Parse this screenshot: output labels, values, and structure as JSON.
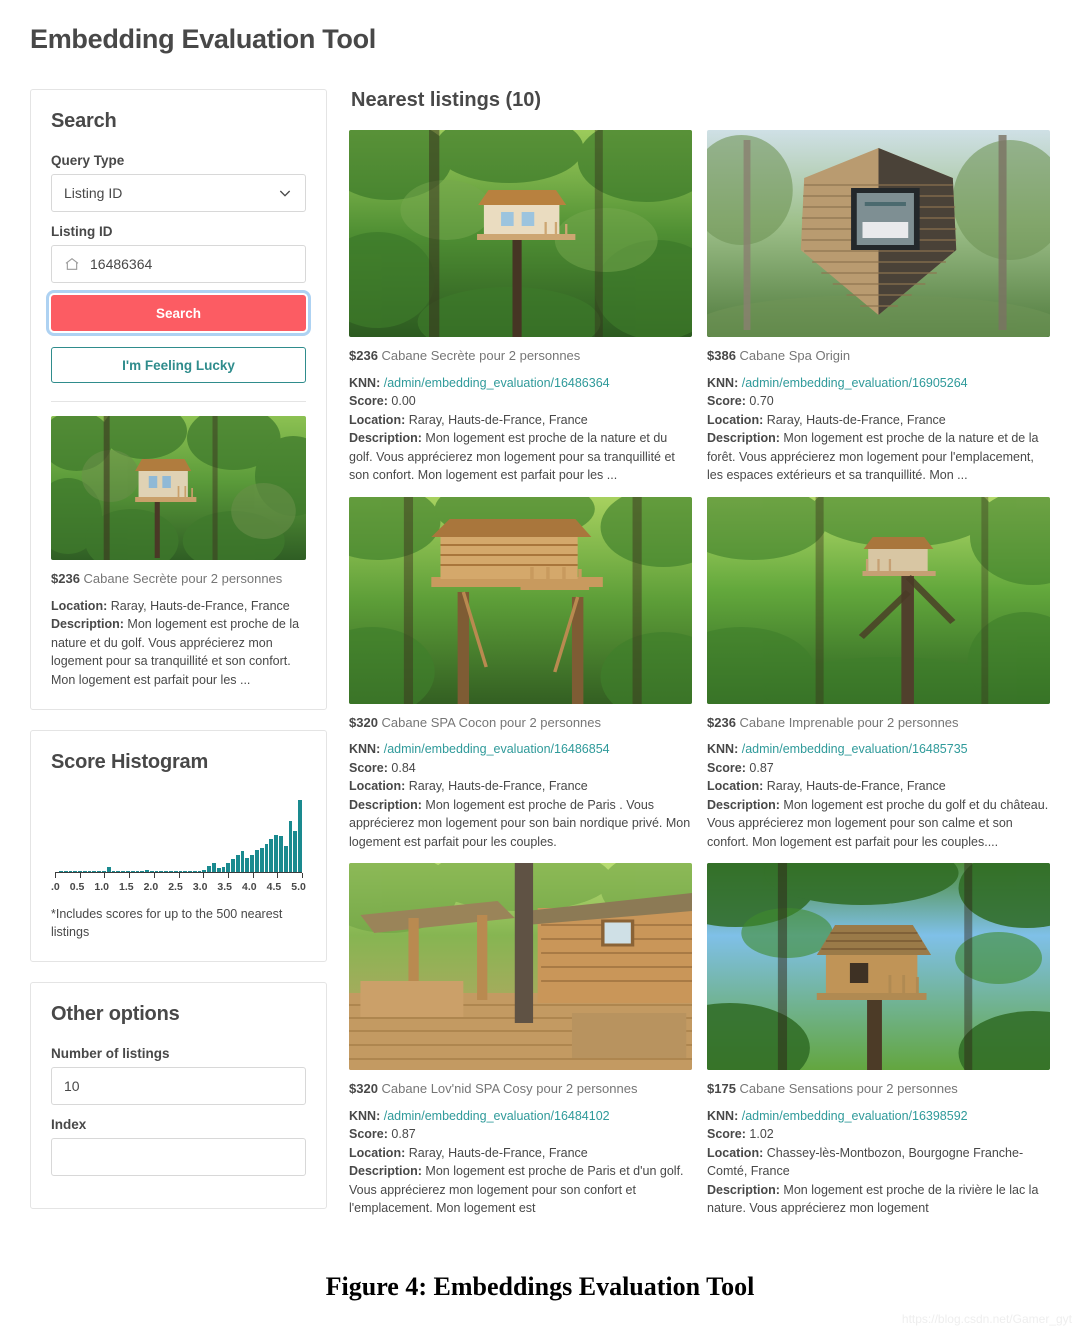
{
  "page": {
    "title": "Embedding Evaluation Tool",
    "caption": "Figure 4: Embeddings Evaluation Tool",
    "watermark": "https://blog.csdn.net/Gamer_gyt"
  },
  "colors": {
    "accent_red": "#fc5c63",
    "teal": "#2f8c8c",
    "link_teal": "#2f9a9a",
    "histogram_bar": "#1a8a8f",
    "text": "#484848",
    "muted": "#767676"
  },
  "search_panel": {
    "title": "Search",
    "query_type_label": "Query Type",
    "query_type_value": "Listing ID",
    "query_type_options": [
      "Listing ID"
    ],
    "listing_id_label": "Listing ID",
    "listing_id_value": "16486364",
    "listing_id_placeholder": "16486364",
    "search_button": "Search",
    "lucky_button": "I'm Feeling Lucky",
    "query_listing": {
      "price": "$236",
      "name": "Cabane Secrète pour 2 personnes",
      "location_label": "Location:",
      "location": "Raray, Hauts-de-France, France",
      "description_label": "Description:",
      "description": "Mon logement est proche de la nature et du golf. Vous apprécierez mon logement pour sa tranquillité et son confort. Mon logement est parfait pour les ..."
    }
  },
  "histogram_panel": {
    "title": "Score Histogram",
    "note": "*Includes scores for up to the 500 nearest listings"
  },
  "chart_data": {
    "type": "bar",
    "title": "Score Histogram",
    "xlabel": "",
    "ylabel": "",
    "grid": false,
    "legend": "none",
    "xlim": [
      0,
      5.2
    ],
    "tick_labels": [
      ".0",
      "0.5",
      "1.0",
      "1.5",
      "2.0",
      "2.5",
      "3.0",
      "3.5",
      "4.0",
      "4.5",
      "5.0"
    ],
    "bin_width": 0.1,
    "bin_centers": [
      0.05,
      0.15,
      0.25,
      0.35,
      0.45,
      0.55,
      0.65,
      0.75,
      0.85,
      0.95,
      1.05,
      1.15,
      1.25,
      1.35,
      1.45,
      1.55,
      1.65,
      1.75,
      1.85,
      1.95,
      2.05,
      2.15,
      2.25,
      2.35,
      2.45,
      2.55,
      2.65,
      2.75,
      2.85,
      2.95,
      3.05,
      3.15,
      3.25,
      3.35,
      3.45,
      3.55,
      3.65,
      3.75,
      3.85,
      3.95,
      4.05,
      4.15,
      4.25,
      4.35,
      4.45,
      4.55,
      4.65,
      4.75,
      4.85,
      4.95
    ],
    "values": [
      1,
      0,
      0,
      0,
      0,
      0,
      0,
      0,
      0,
      0,
      5,
      0,
      1,
      1,
      1,
      1,
      1,
      1,
      2,
      1,
      1,
      1,
      1,
      1,
      1,
      1,
      1,
      1,
      1,
      1,
      2,
      6,
      8,
      4,
      5,
      8,
      12,
      16,
      19,
      13,
      16,
      20,
      22,
      26,
      30,
      34,
      33,
      24,
      47,
      38,
      66
    ],
    "ymax": 70
  },
  "other_options_panel": {
    "title": "Other options",
    "number_of_listings_label": "Number of listings",
    "number_of_listings_value": "10",
    "index_label": "Index"
  },
  "results": {
    "heading": "Nearest listings (10)",
    "labels": {
      "knn": "KNN:",
      "score": "Score:",
      "location": "Location:",
      "description": "Description:"
    },
    "cards": [
      {
        "price": "$236",
        "name": "Cabane Secrète pour 2 personnes",
        "knn_url": "/admin/embedding_evaluation/16486364",
        "score": "0.00",
        "location": "Raray, Hauts-de-France, France",
        "description": "Mon logement est proche de la nature et du golf. Vous apprécierez mon logement pour sa tranquillité et son confort. Mon logement est parfait pour les ...",
        "image": "treehouse-green-forest"
      },
      {
        "price": "$386",
        "name": "Cabane Spa Origin",
        "knn_url": "/admin/embedding_evaluation/16905264",
        "score": "0.70",
        "location": "Raray, Hauts-de-France, France",
        "description": "Mon logement est proche de la nature et de la forêt. Vous apprécierez mon logement pour l'emplacement, les espaces extérieurs et sa tranquillité. Mon ...",
        "image": "modern-slatted-pod-cabin"
      },
      {
        "price": "$320",
        "name": "Cabane SPA Cocon pour 2 personnes",
        "knn_url": "/admin/embedding_evaluation/16486854",
        "score": "0.84",
        "location": "Raray, Hauts-de-France, France",
        "description": "Mon logement est proche de Paris . Vous apprécierez mon logement pour son bain nordique privé. Mon logement est parfait pour les couples.",
        "image": "wooden-treehouse-platform"
      },
      {
        "price": "$236",
        "name": "Cabane Imprenable pour 2 personnes",
        "knn_url": "/admin/embedding_evaluation/16485735",
        "score": "0.87",
        "location": "Raray, Hauts-de-France, France",
        "description": "Mon logement est proche du golf et du château. Vous apprécierez mon logement pour son calme et son confort. Mon logement est parfait pour les couples....",
        "image": "treehouse-in-tall-tree"
      },
      {
        "price": "$320",
        "name": "Cabane Lov'nid SPA Cosy pour 2 personnes",
        "knn_url": "/admin/embedding_evaluation/16484102",
        "score": "0.87",
        "location": "Raray, Hauts-de-France, France",
        "description": "Mon logement est proche de Paris et d'un golf. Vous apprécierez mon logement pour son confort et l'emplacement. Mon logement est",
        "image": "log-cabin-terrace-deck"
      },
      {
        "price": "$175",
        "name": "Cabane Sensations pour 2 personnes",
        "knn_url": "/admin/embedding_evaluation/16398592",
        "score": "1.02",
        "location": "Chassey-lès-Montbozon, Bourgogne Franche-Comté, France",
        "description": "Mon logement est proche de la rivière le lac la nature. Vous apprécierez mon logement",
        "image": "thatched-treehouse-sky"
      }
    ]
  }
}
